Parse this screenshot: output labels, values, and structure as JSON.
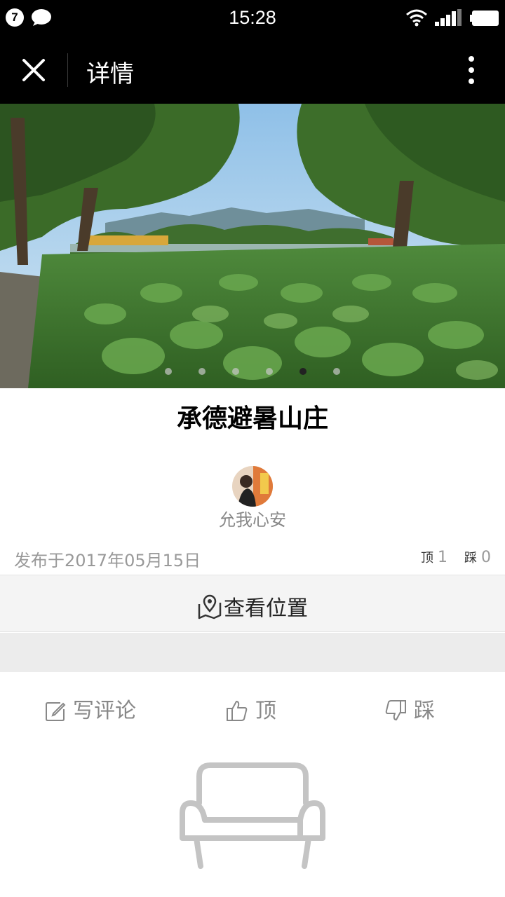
{
  "status_bar": {
    "notification_count": "7",
    "time": "15:28",
    "icons": [
      "chat-bubble-icon",
      "wifi-icon",
      "signal-icon",
      "battery-icon"
    ]
  },
  "nav": {
    "title": "详情",
    "close_icon": "close-icon",
    "more_icon": "more-vertical-icon"
  },
  "gallery": {
    "image_count": 6,
    "active_index": 4
  },
  "post": {
    "title": "承德避暑山庄",
    "author": "允我心安",
    "published": "发布于2017年05月15日",
    "up_label": "顶",
    "up_count": "1",
    "down_label": "踩",
    "down_count": "0"
  },
  "location": {
    "label": "查看位置"
  },
  "actions": {
    "comment": "写评论",
    "up": "顶",
    "down": "踩"
  },
  "colors": {
    "bar_bg": "#000000",
    "muted_text": "#888888",
    "section_bg": "#f4f4f4"
  }
}
